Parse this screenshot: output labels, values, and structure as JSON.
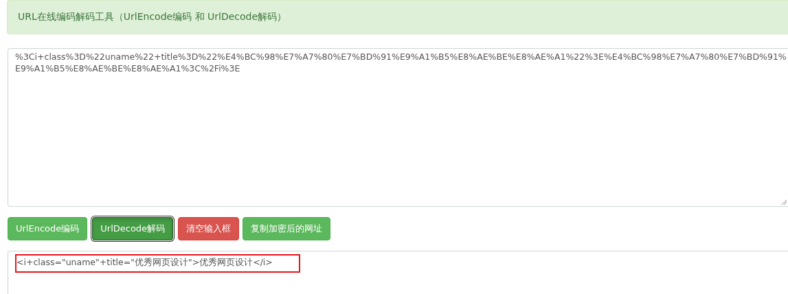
{
  "title": "URL在线编码解码工具（UrlEncode编码 和 UrlDecode解码）",
  "input": {
    "value": "%3Ci+class%3D%22uname%22+title%3D%22%E4%BC%98%E7%A7%80%E7%BD%91%E9%A1%B5%E8%AE%BE%E8%AE%A1%22%3E%E4%BC%98%E7%A7%80%E7%BD%91%E9%A1%B5%E8%AE%BE%E8%AE%A1%3C%2Fi%3E"
  },
  "buttons": [
    {
      "label": "UrlEncode编码",
      "kind": "success",
      "selected": false
    },
    {
      "label": "UrlDecode解码",
      "kind": "success",
      "selected": true
    },
    {
      "label": "清空输入框",
      "kind": "danger",
      "selected": false
    },
    {
      "label": "复制加密后的网址",
      "kind": "success",
      "selected": false
    }
  ],
  "output": {
    "value": "<i+class=\"uname\"+title=\"优秀网页设计\">优秀网页设计</i>",
    "highlighted": true
  }
}
